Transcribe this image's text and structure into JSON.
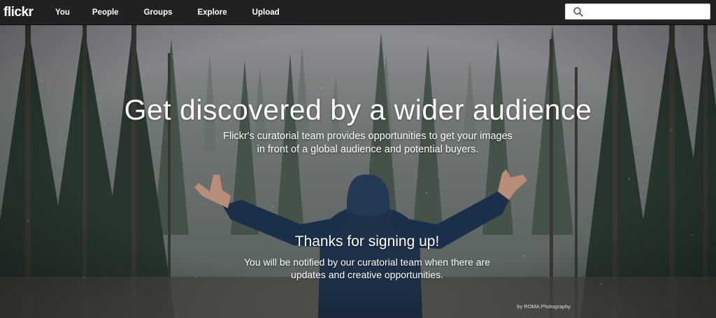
{
  "nav": {
    "logo": "flickr",
    "items": [
      {
        "label": "You"
      },
      {
        "label": "People"
      },
      {
        "label": "Groups"
      },
      {
        "label": "Explore"
      },
      {
        "label": "Upload"
      }
    ],
    "search": {
      "placeholder": "",
      "value": ""
    }
  },
  "hero": {
    "headline": "Get discovered by a wider audience",
    "subtext": "Flickr's curatorial team provides opportunities to get your images in front of a global audience and potential buyers.",
    "thanks": "Thanks for signing up!",
    "notify": "You will be notified by our curatorial team when there are updates and creative opportunities.",
    "credit": "by ROMA Photography"
  },
  "colors": {
    "nav_bg": "#212124",
    "text": "#ffffff",
    "jacket": "#22364f"
  },
  "icons": {
    "search": "search-icon"
  }
}
